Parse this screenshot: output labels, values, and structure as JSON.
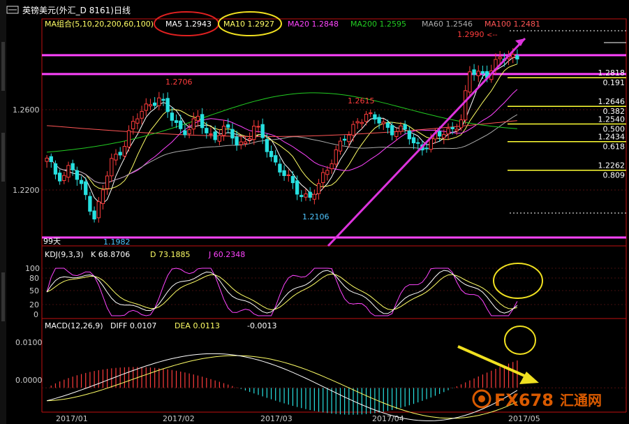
{
  "title": "英镑美元(外汇_D 8161)日线",
  "colors": {
    "up": "#ff3c3c",
    "down": "#27e0e0",
    "ma5": "#ffffff",
    "ma10": "#ffff66",
    "ma20": "#ff44ff",
    "ma200": "#22cc22",
    "ma60": "#aaaaaa",
    "ma100": "#ff5555",
    "hline": "#ff44ff",
    "trend": "#dd33dd",
    "fib": "#ffff33",
    "axis": "#c01010",
    "label_red": "#ff3c3c",
    "label_cyan": "#4fc6ff",
    "watermark": "#ff6a00"
  },
  "ma_legend": {
    "group": "MA组合(5,10,20,200,60,100)",
    "items": [
      {
        "label": "MA5",
        "value": "1.2943",
        "color": "#ffffff"
      },
      {
        "label": "MA10",
        "value": "1.2927",
        "color": "#ffff66"
      },
      {
        "label": "MA20",
        "value": "1.2848",
        "color": "#ff44ff"
      },
      {
        "label": "MA200",
        "value": "1.2595",
        "color": "#22cc22"
      },
      {
        "label": "MA60",
        "value": "1.2546",
        "color": "#aaaaaa"
      },
      {
        "label": "MA100",
        "value": "1.2481",
        "color": "#ff5555"
      }
    ]
  },
  "price_ticks": [
    "1.2600",
    "1.2200",
    "0.0100",
    "0.0000"
  ],
  "kdj_ticks": [
    "100",
    "80",
    "50",
    "20",
    "0"
  ],
  "x_ticks": [
    "2017/01",
    "2017/02",
    "2017/03",
    "2017/04",
    "2017/05"
  ],
  "annotations": {
    "peak_feb": "1.2706",
    "low_mar": "1.2106",
    "low_jan": "1.1982",
    "peak_mar": "1.2615",
    "last_high": "1.2990",
    "support_label": "99天"
  },
  "fib_levels": [
    {
      "price": "1.2818",
      "ratio": "0.191"
    },
    {
      "price": "1.2646",
      "ratio": "0.382"
    },
    {
      "price": "1.2540",
      "ratio": "0.500"
    },
    {
      "price": "1.2434",
      "ratio": "0.618"
    },
    {
      "price": "1.2262",
      "ratio": "0.809"
    }
  ],
  "kdj": {
    "label": "KDJ(9,3,3)",
    "k": "68.8706",
    "d": "73.1885",
    "j": "60.2348",
    "k_label": "K",
    "d_label": "D",
    "j_label": "J"
  },
  "macd": {
    "label": "MACD(12,26,9)",
    "diff": "0.0107",
    "dea": "0.0113",
    "macd": "-0.0013",
    "diff_label": "DIFF",
    "dea_label": "DEA"
  },
  "watermark": {
    "brand": "FX678",
    "cn": "汇通网"
  },
  "chart_data": {
    "type": "candlestick",
    "title": "英镑美元(外汇_D 8161)日线",
    "x_ticks": [
      "2017/01",
      "2017/02",
      "2017/03",
      "2017/04",
      "2017/05"
    ],
    "ylim": [
      1.19,
      1.31
    ],
    "close_path": [
      1.232,
      1.225,
      1.222,
      1.23,
      1.218,
      1.21,
      1.198,
      1.213,
      1.231,
      1.236,
      1.246,
      1.255,
      1.262,
      1.267,
      1.27,
      1.262,
      1.255,
      1.25,
      1.252,
      1.257,
      1.249,
      1.246,
      1.251,
      1.248,
      1.242,
      1.244,
      1.252,
      1.246,
      1.236,
      1.228,
      1.222,
      1.216,
      1.212,
      1.21,
      1.215,
      1.226,
      1.236,
      1.244,
      1.247,
      1.256,
      1.261,
      1.257,
      1.254,
      1.25,
      1.252,
      1.249,
      1.242,
      1.24,
      1.244,
      1.246,
      1.249,
      1.252,
      1.257,
      1.284,
      1.286,
      1.283,
      1.289,
      1.292,
      1.296,
      1.294
    ],
    "support_levels": [
      1.288,
      1.282
    ],
    "fibonacci": [
      {
        "ratio": 0.191,
        "price": 1.2818
      },
      {
        "ratio": 0.382,
        "price": 1.2646
      },
      {
        "ratio": 0.5,
        "price": 1.254
      },
      {
        "ratio": 0.618,
        "price": 1.2434
      },
      {
        "ratio": 0.809,
        "price": 1.2262
      }
    ],
    "labels": {
      "high_feb": 1.2706,
      "low_jan": 1.1982,
      "high_mar": 1.2615,
      "low_mar": 1.2106,
      "last_high": 1.299
    },
    "ma_last": {
      "MA5": 1.2943,
      "MA10": 1.2927,
      "MA20": 1.2848,
      "MA200": 1.2595,
      "MA60": 1.2546,
      "MA100": 1.2481
    },
    "kdj_last": {
      "K": 68.8706,
      "D": 73.1885,
      "J": 60.2348
    },
    "macd_last": {
      "DIFF": 0.0107,
      "DEA": 0.0113,
      "MACD": -0.0013
    },
    "kdj_ylim": [
      0,
      100
    ],
    "macd_ylim": [
      -0.006,
      0.016
    ]
  }
}
